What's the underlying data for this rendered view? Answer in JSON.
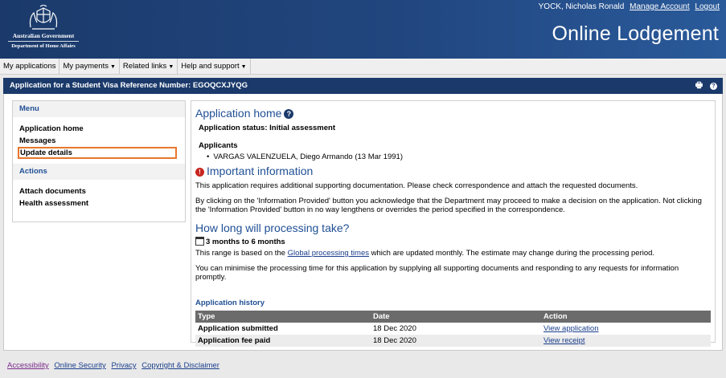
{
  "header": {
    "gov_name": "Australian Government",
    "dept_name": "Department of Home Affairs",
    "user_name": "YOCK, Nicholas Ronald",
    "manage_account": "Manage Account",
    "logout": "Logout",
    "app_title": "Online Lodgement"
  },
  "nav": {
    "items": [
      {
        "label": "My applications"
      },
      {
        "label": "My payments"
      },
      {
        "label": "Related links"
      },
      {
        "label": "Help and support"
      }
    ]
  },
  "titlebar": {
    "title": "Application for a Student Visa Reference Number: EGOQCXJYQG",
    "print_icon": "print-icon",
    "help_icon": "help-icon"
  },
  "menu": {
    "heading": "Menu",
    "items": [
      "Application home",
      "Messages",
      "Update details"
    ],
    "selected": "Update details",
    "actions_heading": "Actions",
    "actions": [
      "Attach documents",
      "Health assessment"
    ]
  },
  "main": {
    "title": "Application home",
    "status": "Application status: Initial assessment",
    "applicants_heading": "Applicants",
    "applicant": "VARGAS VALENZUELA, Diego Armando (13 Mar 1991)",
    "important_heading": "Important information",
    "important_p1": "This application requires additional supporting documentation. Please check correspondence and attach the requested documents.",
    "important_p2": "By clicking on the 'Information Provided' button you acknowledge that the Department may proceed to make a decision on the application. Not clicking the 'Information Provided' button in no way lengthens or overrides the period specified in the correspondence.",
    "processing_heading": "How long will processing take?",
    "estimate": "3 months to 6 months",
    "range_prefix": "This range is based on the ",
    "range_link": "Global processing times",
    "range_suffix": " which are updated monthly. The estimate may change during the processing period.",
    "minimise": "You can minimise the processing time for this application by supplying all supporting documents and responding to any requests for information promptly.",
    "history_heading": "Application history",
    "history_columns": [
      "Type",
      "Date",
      "Action"
    ],
    "history_rows": [
      {
        "type": "Application submitted",
        "date": "18 Dec 2020",
        "action": "View application"
      },
      {
        "type": "Application fee paid",
        "date": "18 Dec 2020",
        "action": "View receipt"
      }
    ]
  },
  "footer": {
    "links": [
      "Accessibility",
      "Online Security",
      "Privacy",
      "Copyright & Disclaimer"
    ]
  },
  "colors": {
    "brand_navy": "#1b3a6b",
    "link_blue": "#1f4f94",
    "focus_orange": "#e8762b",
    "alert_red": "#c8251f"
  }
}
